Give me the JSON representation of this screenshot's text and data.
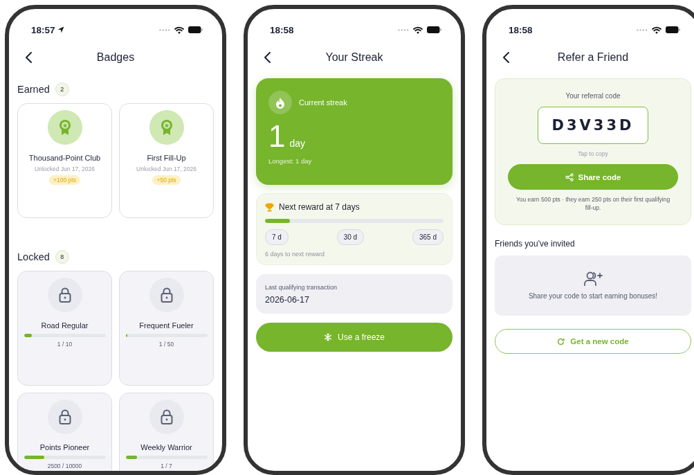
{
  "screens": [
    {
      "kind": "badges",
      "status_bar": {
        "time": "18:57",
        "location": true
      },
      "title": "Badges",
      "sections": [
        {
          "label": "Earned",
          "count": "2",
          "badges": [
            {
              "kind": "earned",
              "name": "Thousand-Point Club",
              "subtitle": "Unlocked Jun 17, 2026",
              "points": "+100 pts"
            },
            {
              "kind": "earned",
              "name": "First Fill-Up",
              "subtitle": "Unlocked Jun 17, 2026",
              "points": "+50 pts"
            }
          ]
        },
        {
          "label": "Locked",
          "count": "8",
          "badges": [
            {
              "kind": "locked",
              "name": "Road Regular",
              "level": 0.1,
              "progress": "1 / 10"
            },
            {
              "kind": "locked",
              "name": "Frequent Fueler",
              "level": 0.02,
              "progress": "1 / 50"
            },
            {
              "kind": "locked",
              "name": "Points Pioneer",
              "level": 0.25,
              "progress": "2500 / 10000"
            },
            {
              "kind": "locked",
              "name": "Weekly Warrior",
              "level": 0.14,
              "progress": "1 / 7"
            }
          ]
        }
      ]
    },
    {
      "kind": "streak",
      "status_bar": {
        "time": "18:58",
        "location": false
      },
      "title": "Your Streak",
      "hero": {
        "label": "Current streak",
        "value": "1",
        "unit": "day",
        "longest": "Longest: 1 day"
      },
      "reward": {
        "title": "Next reward at 7 days",
        "level": 0.14,
        "milestones": [
          "7 d",
          "30 d",
          "365 d"
        ],
        "note": "6 days to next reward"
      },
      "last": {
        "label": "Last qualifying transaction",
        "value": "2026-06-17"
      },
      "button": "Use a freeze"
    },
    {
      "kind": "referral",
      "status_bar": {
        "time": "18:58",
        "location": false
      },
      "title": "Refer a Friend",
      "code_card": {
        "label": "Your referral code",
        "code": "D3V33D",
        "hint": "Tap to copy",
        "button": "Share code",
        "note": "You earn 500 pts · they earn 250 pts on their first qualifying fill-up."
      },
      "friends": {
        "label": "Friends you've invited",
        "empty": "Share your code to start earning bonuses!"
      },
      "button": "Get a new code"
    }
  ]
}
